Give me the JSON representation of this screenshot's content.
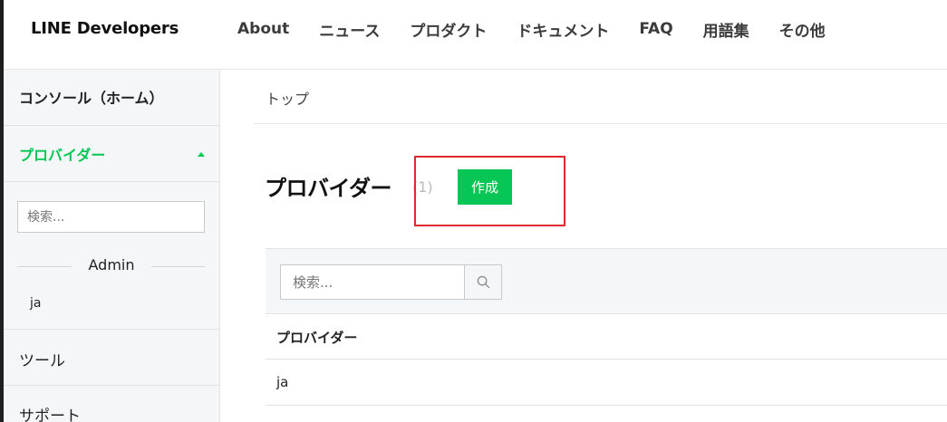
{
  "header": {
    "brand": "LINE Developers",
    "nav": [
      "About",
      "ニュース",
      "プロダクト",
      "ドキュメント",
      "FAQ",
      "用語集",
      "その他"
    ]
  },
  "sidebar": {
    "home": "コンソール（ホーム）",
    "provider": "プロバイダー",
    "search_placeholder": "検索...",
    "group_label": "Admin",
    "provider_items": [
      "ja"
    ],
    "tools": "ツール",
    "support": "サポート"
  },
  "main": {
    "breadcrumb": "トップ",
    "title": "プロバイダー",
    "count": "(1)",
    "create_label": "作成",
    "search_placeholder": "検索...",
    "table": {
      "header": "プロバイダー",
      "rows": [
        "ja"
      ]
    }
  },
  "colors": {
    "accent": "#06c755",
    "highlight": "#e0282e"
  },
  "icons": {
    "caret": "caret-up-icon",
    "search": "search-icon"
  }
}
